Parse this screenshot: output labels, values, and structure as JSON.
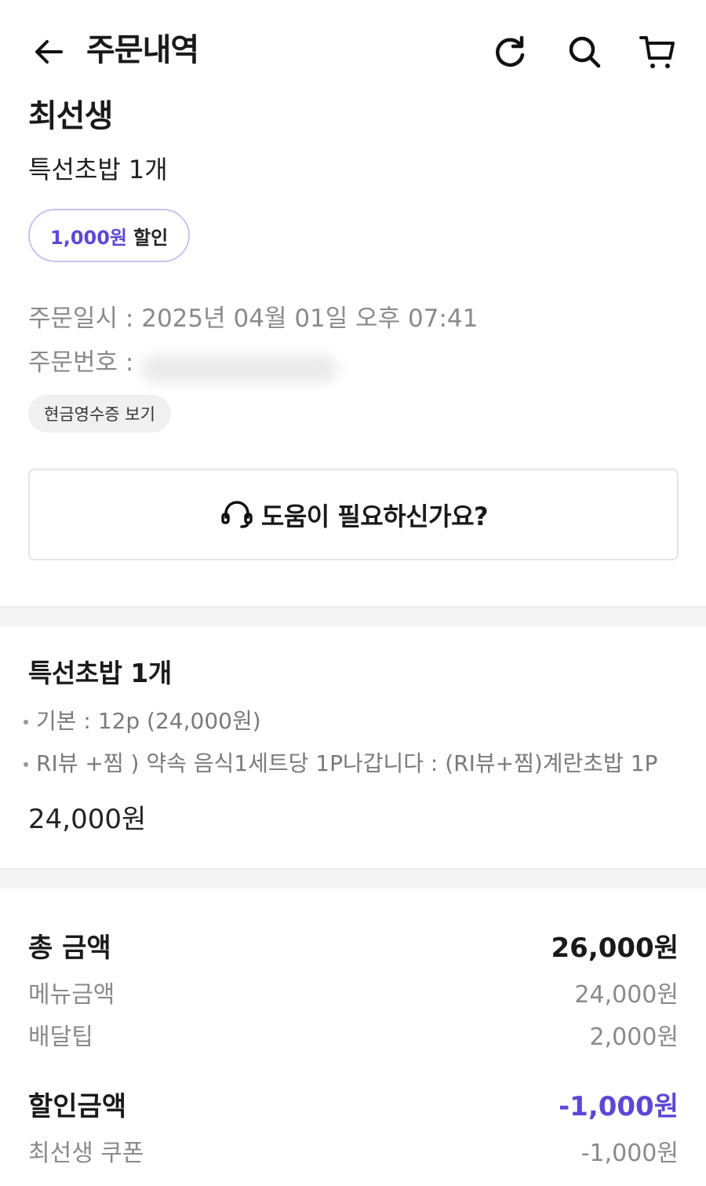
{
  "header": {
    "title": "주문내역",
    "icons": [
      "back-arrow-icon",
      "refresh-icon",
      "search-icon",
      "cart-icon"
    ]
  },
  "store": {
    "name": "최선생",
    "summary": "특선초밥 1개",
    "discount_amount": "1,000원",
    "discount_text": "할인"
  },
  "order_info": {
    "date_line": "주문일시 : 2025년 04월 01일 오후 07:41",
    "number_label": "주문번호 :",
    "receipt_button": "현금영수증 보기"
  },
  "help": {
    "label": "도움이 필요하신가요?"
  },
  "menu": {
    "title": "특선초밥 1개",
    "options": [
      "기본 : 12p (24,000원)",
      "RI뷰 +찜 ) 약속 음식1세트당 1P나갑니다 : (RI뷰+찜)계란초밥 1P"
    ],
    "price": "24,000원"
  },
  "payment": {
    "total_label": "총 금액",
    "total_value": "26,000원",
    "menu_label": "메뉴금액",
    "menu_value": "24,000원",
    "tip_label": "배달팁",
    "tip_value": "2,000원",
    "discount_label": "할인금액",
    "discount_value": "-1,000원",
    "coupon_label": "최선생 쿠폰",
    "coupon_value": "-1,000원"
  },
  "colors": {
    "accent": "#5b48d6",
    "pill_border": "#c9c2ee",
    "muted_text": "#8a8a8a",
    "divider": "#f5f5f5"
  }
}
